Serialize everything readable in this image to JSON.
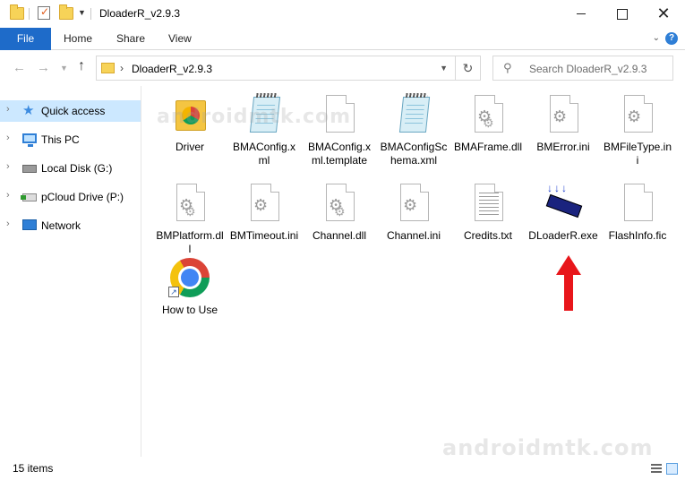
{
  "window": {
    "title": "DloaderR_v2.9.3",
    "minimize_glyph": "",
    "maximize_glyph": "",
    "close_glyph": "✕"
  },
  "ribbon": {
    "tabs": [
      "File",
      "Home",
      "Share",
      "View"
    ],
    "help": "?"
  },
  "address": {
    "path": "DloaderR_v2.9.3",
    "chevron": "›",
    "search_placeholder": "Search DloaderR_v2.9.3"
  },
  "sidebar": {
    "items": [
      {
        "label": "Quick access",
        "icon": "star-icon",
        "selected": true
      },
      {
        "label": "This PC",
        "icon": "computer-icon",
        "selected": false
      },
      {
        "label": "Local Disk (G:)",
        "icon": "disk-icon",
        "selected": false
      },
      {
        "label": "pCloud Drive (P:)",
        "icon": "cloud-drive-icon",
        "selected": false
      },
      {
        "label": "Network",
        "icon": "network-icon",
        "selected": false
      }
    ]
  },
  "files": [
    {
      "label": "Driver",
      "icon": "folder-icon"
    },
    {
      "label": "BMAConfig.xml",
      "icon": "xml-document-icon"
    },
    {
      "label": "BMAConfig.xml.template",
      "icon": "blank-document-icon"
    },
    {
      "label": "BMAConfigSchema.xml",
      "icon": "xml-document-icon"
    },
    {
      "label": "BMAFrame.dll",
      "icon": "dll-gear-icon"
    },
    {
      "label": "BMError.ini",
      "icon": "ini-gear-icon"
    },
    {
      "label": "BMFileType.ini",
      "icon": "ini-gear-icon"
    },
    {
      "label": "BMPlatform.dll",
      "icon": "dll-gear-icon"
    },
    {
      "label": "BMTimeout.ini",
      "icon": "ini-gear-icon"
    },
    {
      "label": "Channel.dll",
      "icon": "dll-gear-icon"
    },
    {
      "label": "Channel.ini",
      "icon": "ini-gear-icon"
    },
    {
      "label": "Credits.txt",
      "icon": "text-document-icon"
    },
    {
      "label": "DLoaderR.exe",
      "icon": "chip-exe-icon"
    },
    {
      "label": "FlashInfo.fic",
      "icon": "blank-document-icon"
    },
    {
      "label": "How to Use",
      "icon": "chrome-shortcut-icon"
    }
  ],
  "status": {
    "item_count": "15 items"
  },
  "watermark": "androidmtk.com",
  "colors": {
    "accent": "#1e6bc9",
    "selection": "#cce8ff",
    "annotation_arrow": "#e8161b"
  }
}
